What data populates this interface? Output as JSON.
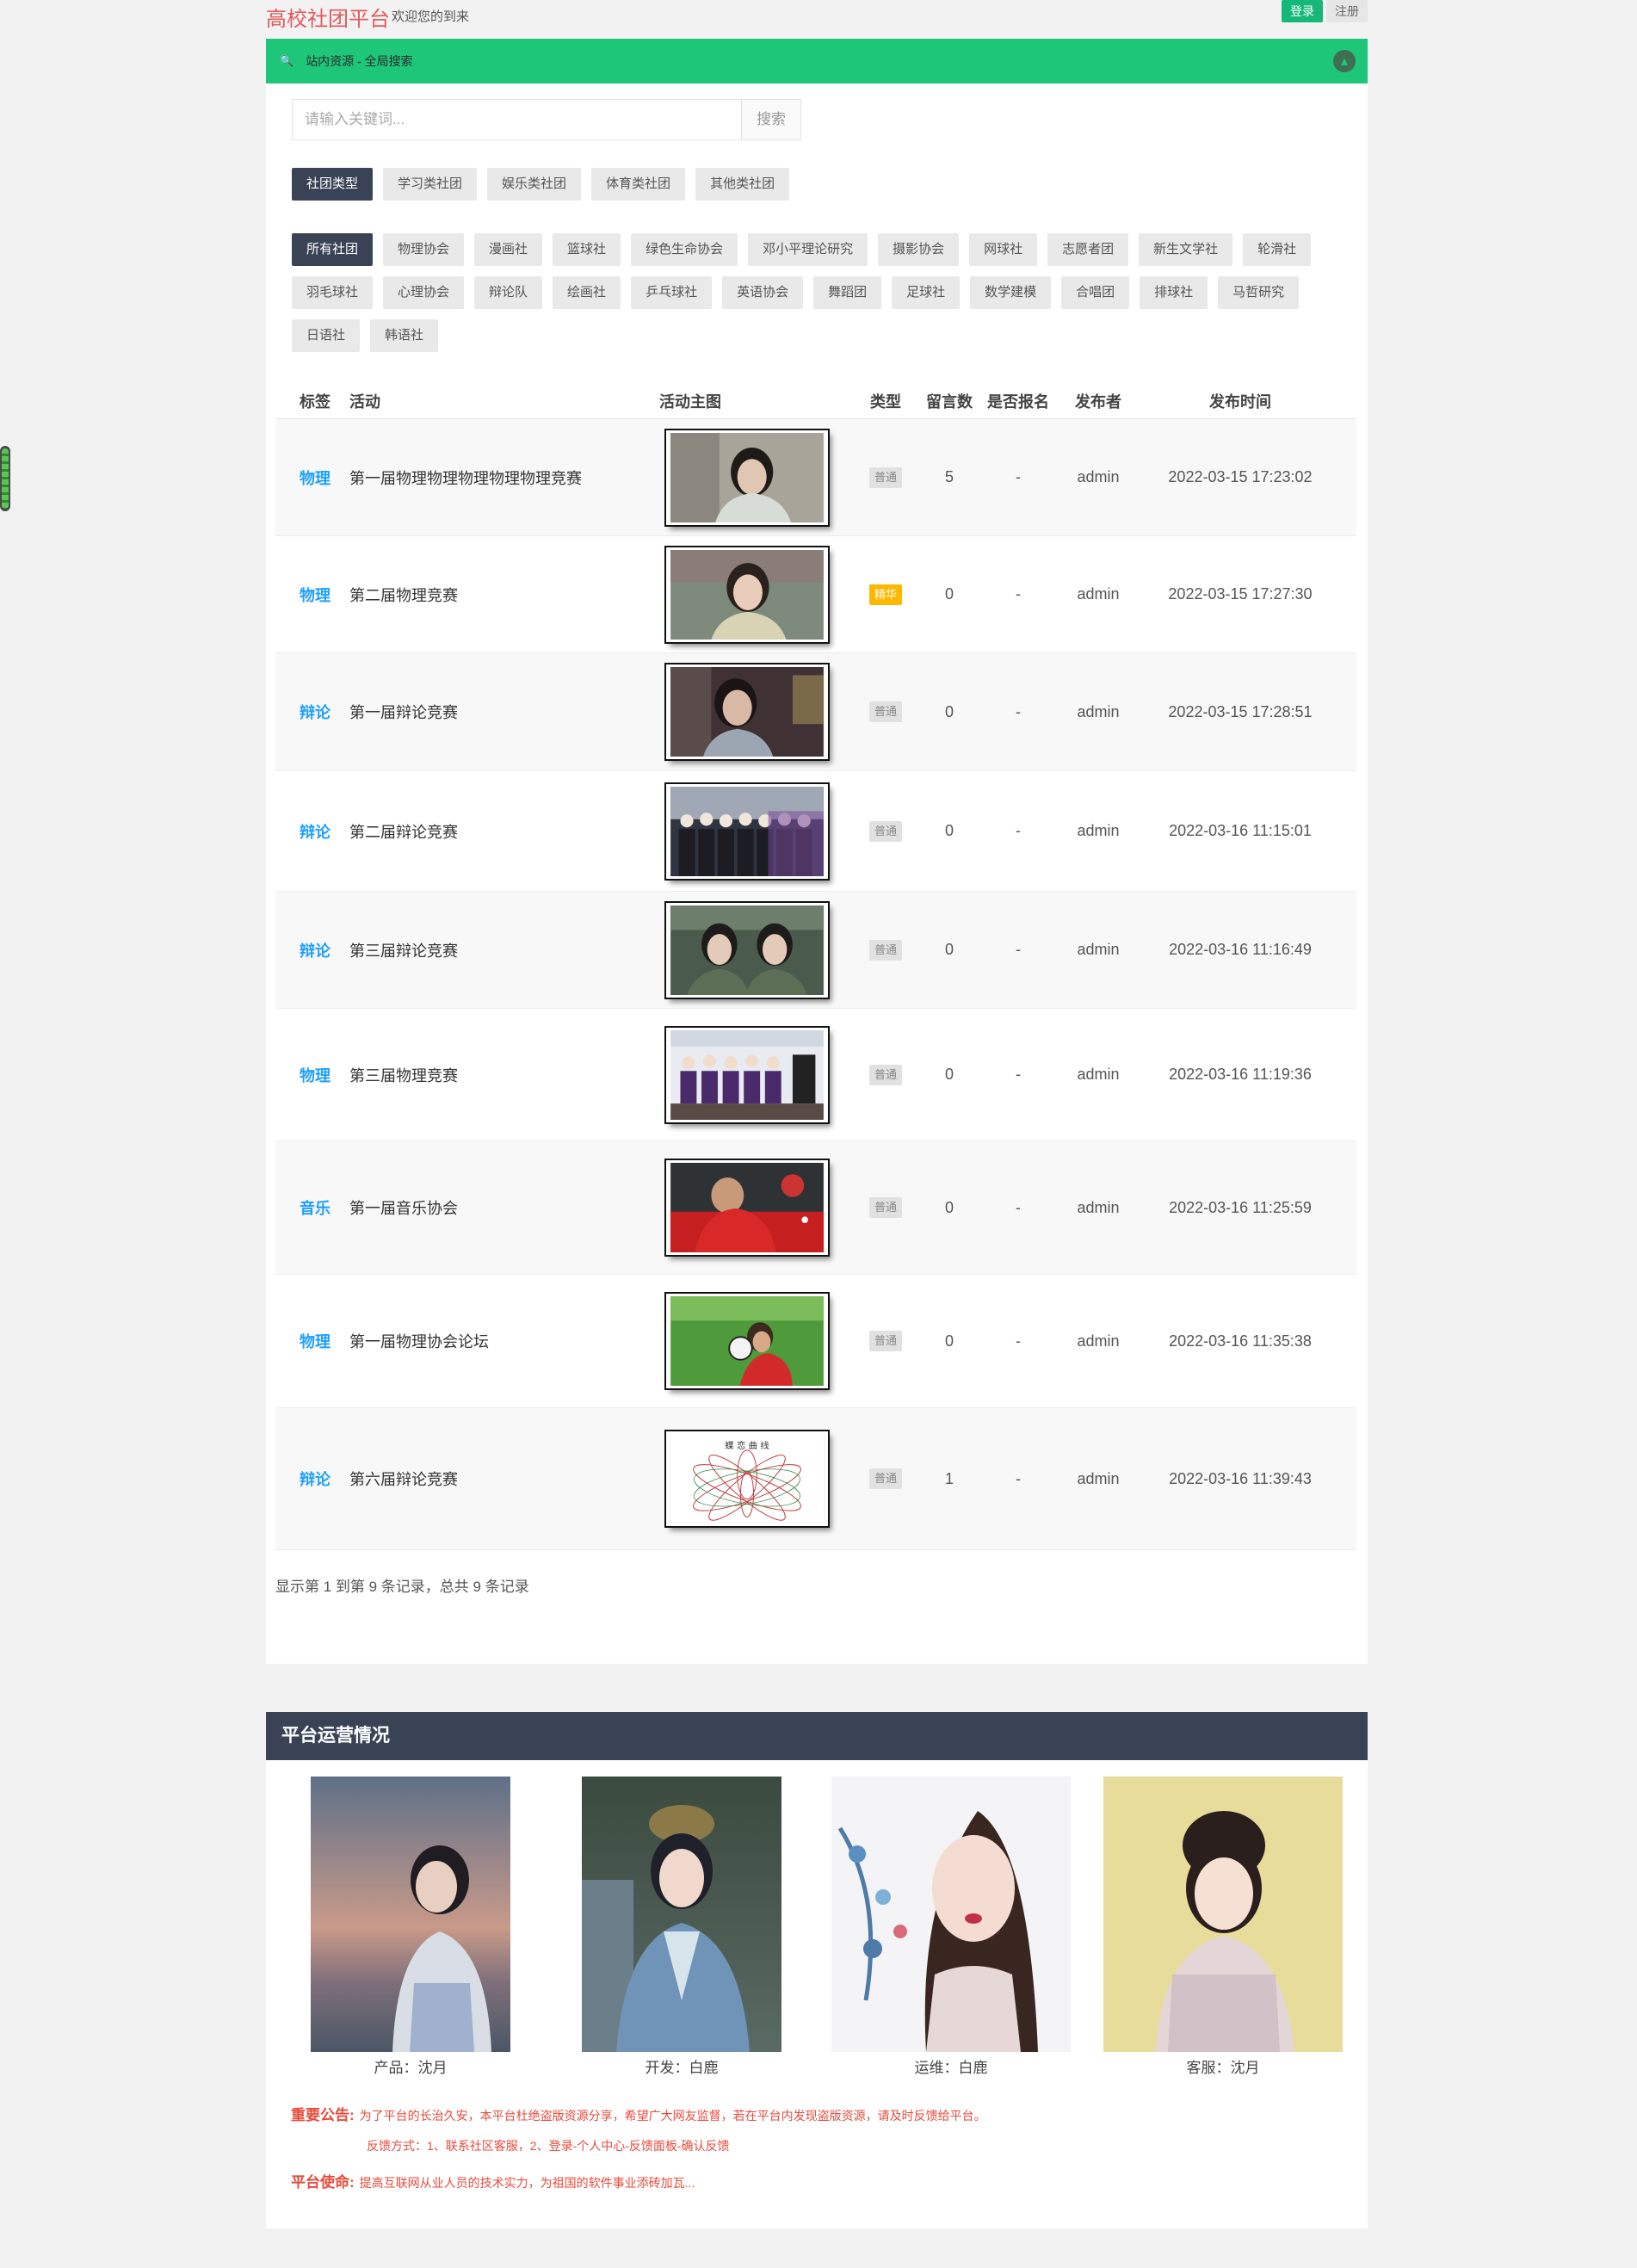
{
  "header": {
    "brand": "高校社团平台",
    "welcome": "欢迎您的到来",
    "login_label": "登录",
    "register_label": "注册"
  },
  "search_panel": {
    "title": "站内资源 - 全局搜索",
    "search_placeholder": "请输入关键词...",
    "search_button": "搜索",
    "club_types": [
      "社团类型",
      "学习类社团",
      "娱乐类社团",
      "体育类社团",
      "其他类社团"
    ],
    "clubs": [
      "所有社团",
      "物理协会",
      "漫画社",
      "篮球社",
      "绿色生命协会",
      "邓小平理论研究",
      "摄影协会",
      "网球社",
      "志愿者团",
      "新生文学社",
      "轮滑社",
      "羽毛球社",
      "心理协会",
      "辩论队",
      "绘画社",
      "乒乓球社",
      "英语协会",
      "舞蹈团",
      "足球社",
      "数学建模",
      "合唱团",
      "排球社",
      "马哲研究",
      "日语社",
      "韩语社"
    ]
  },
  "table": {
    "headers": [
      "标签",
      "活动",
      "活动主图",
      "类型",
      "留言数",
      "是否报名",
      "发布者",
      "发布时间"
    ],
    "rows": [
      {
        "tag": "物理",
        "activity": "第一届物理物理物理物理物理竞赛",
        "type": "普通",
        "comments": "5",
        "signup": "-",
        "publisher": "admin",
        "time": "2022-03-15 17:23:02"
      },
      {
        "tag": "物理",
        "activity": "第二届物理竞赛",
        "type": "精华",
        "comments": "0",
        "signup": "-",
        "publisher": "admin",
        "time": "2022-03-15 17:27:30"
      },
      {
        "tag": "辩论",
        "activity": "第一届辩论竞赛",
        "type": "普通",
        "comments": "0",
        "signup": "-",
        "publisher": "admin",
        "time": "2022-03-15 17:28:51"
      },
      {
        "tag": "辩论",
        "activity": "第二届辩论竞赛",
        "type": "普通",
        "comments": "0",
        "signup": "-",
        "publisher": "admin",
        "time": "2022-03-16 11:15:01"
      },
      {
        "tag": "辩论",
        "activity": "第三届辩论竞赛",
        "type": "普通",
        "comments": "0",
        "signup": "-",
        "publisher": "admin",
        "time": "2022-03-16 11:16:49"
      },
      {
        "tag": "物理",
        "activity": "第三届物理竞赛",
        "type": "普通",
        "comments": "0",
        "signup": "-",
        "publisher": "admin",
        "time": "2022-03-16 11:19:36"
      },
      {
        "tag": "音乐",
        "activity": "第一届音乐协会",
        "type": "普通",
        "comments": "0",
        "signup": "-",
        "publisher": "admin",
        "time": "2022-03-16 11:25:59"
      },
      {
        "tag": "物理",
        "activity": "第一届物理协会论坛",
        "type": "普通",
        "comments": "0",
        "signup": "-",
        "publisher": "admin",
        "time": "2022-03-16 11:35:38"
      },
      {
        "tag": "辩论",
        "activity": "第六届辩论竞赛",
        "type": "普通",
        "comments": "1",
        "signup": "-",
        "publisher": "admin",
        "time": "2022-03-16 11:39:43"
      }
    ],
    "pager_info": "显示第 1 到第 9 条记录，总共 9 条记录"
  },
  "operations": {
    "title": "平台运营情况",
    "staff": [
      {
        "caption": "产品：沈月"
      },
      {
        "caption": "开发：白鹿"
      },
      {
        "caption": "运维：白鹿"
      },
      {
        "caption": "客服：沈月"
      }
    ],
    "notice_label": "重要公告:",
    "notice_text": "为了平台的长治久安，本平台杜绝盗版资源分享，希望广大网友监督，若在平台内发现盗版资源，请及时反馈给平台。",
    "feedback_text": "反馈方式：1、联系社区客服，2、登录-个人中心-反馈面板-确认反馈",
    "mission_label": "平台使命:",
    "mission_text": "提高互联网从业人员的技术实力，为祖国的软件事业添砖加瓦..."
  },
  "colors": {
    "brand": "#e25a5a",
    "green": "#1ec67a",
    "dark": "#3a4356",
    "link": "#1e9fff",
    "featured": "#ffb800",
    "notice": "#e84a3a"
  }
}
